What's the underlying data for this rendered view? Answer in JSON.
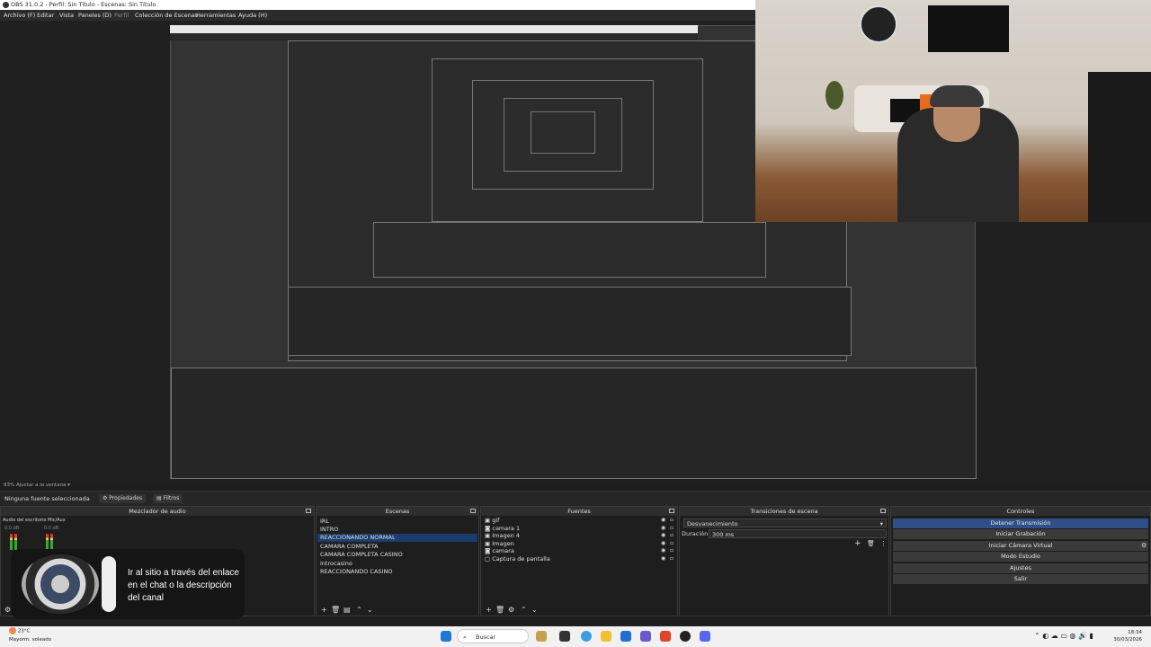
{
  "window": {
    "title": "OBS 31.0.2 - Perfil: Sin Título - Escenas: Sin Título"
  },
  "menu": [
    "Archivo (F)",
    "Editar",
    "Vista",
    "Paneles (D)",
    "Perfil",
    "Colección de Escenas",
    "Herramientas",
    "Ayuda (H)"
  ],
  "status": {
    "zoom": "93%  Ajustar a la ventana"
  },
  "sources_bar": {
    "none_selected": "Ninguna fuente seleccionada",
    "properties": "Propiedades",
    "filters": "Filtros"
  },
  "audio_mixer": {
    "title": "Mezclador de audio",
    "channels": [
      {
        "name": "Audio del escritorio",
        "db": "0.0 dB"
      },
      {
        "name": "Mic/Aux",
        "db": "0.0 dB"
      }
    ]
  },
  "scenes": {
    "title": "Escenas",
    "items": [
      "IRL",
      "INTRO",
      "REACCIONANDO NORMAL",
      "CAMARA COMPLETA",
      "CAMARA COMPLETA CASINO",
      "introcasino",
      "REACCIONANDO CASINO"
    ],
    "selected": "REACCIONANDO NORMAL"
  },
  "sources": {
    "title": "Fuentes",
    "items": [
      "gif",
      "camara 1",
      "Imagen 4",
      "Imagen",
      "camara",
      "Captura de pantalla"
    ]
  },
  "transitions": {
    "title": "Transiciones de escena",
    "type": "Desvanecimiento",
    "duration_label": "Duración",
    "duration": "300 ms"
  },
  "controls": {
    "title": "Controles",
    "buttons": [
      "Detener Transmisión",
      "Iniciar Grabación",
      "Iniciar Cámara Virtual",
      "Modo Estudio",
      "Ajustes",
      "Salir"
    ]
  },
  "banner": {
    "text": "Ir al sitio a través del enlace en el chat o la descripción del canal"
  },
  "taskbar": {
    "weather_temp": "23°C",
    "weather_desc": "Mayorm. soleado",
    "search": "Buscar",
    "time": "18:34",
    "date": "30/03/2026"
  },
  "colors": {
    "accent": "#2f4f86",
    "selection": "#1b3d6e",
    "panel": "#1e1e1e"
  }
}
